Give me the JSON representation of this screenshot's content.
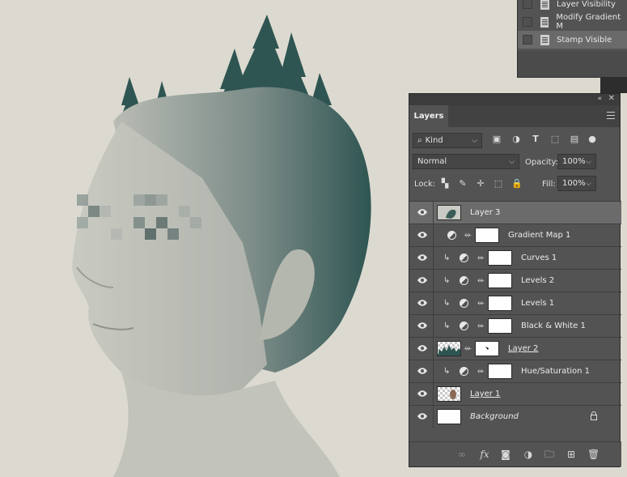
{
  "actions_panel": {
    "items": [
      {
        "label": "Layer Visibility"
      },
      {
        "label": "Modify Gradient M"
      },
      {
        "label": "Stamp Visible"
      }
    ]
  },
  "layers_panel": {
    "tab_label": "Layers",
    "filter_kind": "Kind",
    "blend_mode": "Normal",
    "opacity_label": "Opacity:",
    "opacity_value": "100%",
    "lock_label": "Lock:",
    "fill_label": "Fill:",
    "fill_value": "100%",
    "layers": [
      {
        "name": "Layer 3",
        "selected": true
      },
      {
        "name": "Gradient Map 1"
      },
      {
        "name": "Curves 1"
      },
      {
        "name": "Levels 2"
      },
      {
        "name": "Levels 1"
      },
      {
        "name": "Black & White 1"
      },
      {
        "name": "Layer 2"
      },
      {
        "name": "Hue/Saturation 1"
      },
      {
        "name": "Layer 1"
      },
      {
        "name": "Background"
      }
    ]
  },
  "icons": [
    "eye-icon",
    "link-icon",
    "fx-icon",
    "mask-icon",
    "adjustment-icon",
    "folder-icon",
    "new-layer-icon",
    "trash-icon",
    "lock-icon",
    "panel-menu-icon"
  ],
  "colors": {
    "canvas_bg": "#dcdad0",
    "tint": "#2f5552",
    "panel_bg": "#535353"
  }
}
